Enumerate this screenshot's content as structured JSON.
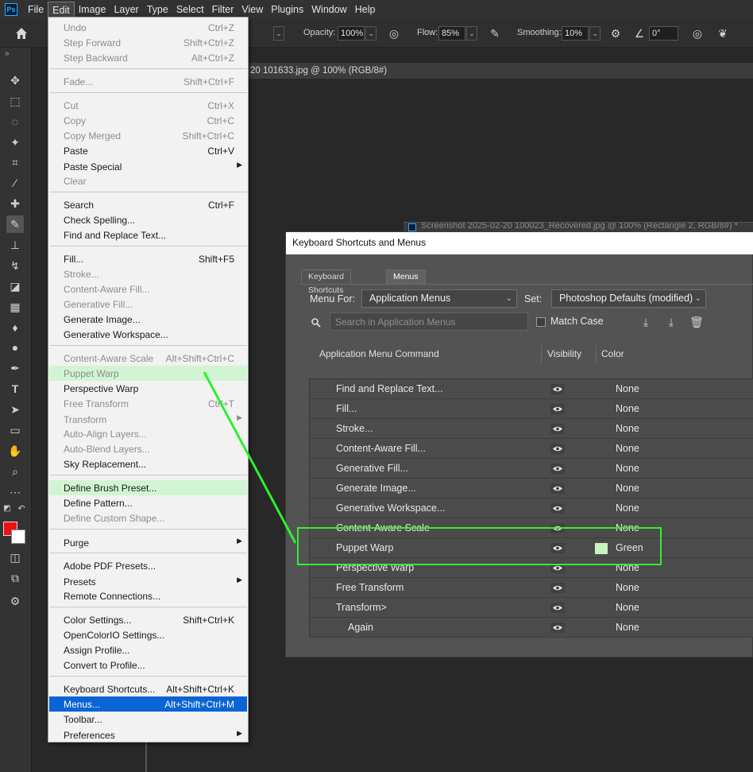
{
  "menubar": {
    "logo": "Ps",
    "items": [
      "File",
      "Edit",
      "Image",
      "Layer",
      "Type",
      "Select",
      "Filter",
      "View",
      "Plugins",
      "Window",
      "Help"
    ],
    "active": "Edit"
  },
  "options": {
    "opacity_label": "Opacity:",
    "opacity_value": "100%",
    "flow_label": "Flow:",
    "flow_value": "85%",
    "smoothing_label": "Smoothing:",
    "smoothing_value": "10%",
    "angle_value": "0°"
  },
  "doc": {
    "tab_title": "20 101633.jpg @ 100% (RGB/8#)",
    "second_tab_title": "Screenshot 2025-02-20 100023_Recovered.jpg @ 100% (Rectangle 2, RGB/8#) *"
  },
  "edit_menu": {
    "items": [
      {
        "label": "Undo",
        "shortcut": "Ctrl+Z",
        "disabled": true
      },
      {
        "label": "Step Forward",
        "shortcut": "Shift+Ctrl+Z",
        "disabled": true
      },
      {
        "label": "Step Backward",
        "shortcut": "Alt+Ctrl+Z",
        "disabled": true
      },
      {
        "label": "Fade...",
        "shortcut": "Shift+Ctrl+F",
        "disabled": true
      },
      {
        "label": "Cut",
        "shortcut": "Ctrl+X",
        "disabled": true
      },
      {
        "label": "Copy",
        "shortcut": "Ctrl+C",
        "disabled": true
      },
      {
        "label": "Copy Merged",
        "shortcut": "Shift+Ctrl+C",
        "disabled": true
      },
      {
        "label": "Paste",
        "shortcut": "Ctrl+V",
        "disabled": false
      },
      {
        "label": "Paste Special",
        "shortcut": "",
        "disabled": false,
        "submenu": true
      },
      {
        "label": "Clear",
        "shortcut": "",
        "disabled": true
      },
      {
        "label": "Search",
        "shortcut": "Ctrl+F",
        "disabled": false
      },
      {
        "label": "Check Spelling...",
        "shortcut": "",
        "disabled": false
      },
      {
        "label": "Find and Replace Text...",
        "shortcut": "",
        "disabled": false
      },
      {
        "label": "Fill...",
        "shortcut": "Shift+F5",
        "disabled": false
      },
      {
        "label": "Stroke...",
        "shortcut": "",
        "disabled": true
      },
      {
        "label": "Content-Aware Fill...",
        "shortcut": "",
        "disabled": true
      },
      {
        "label": "Generative Fill...",
        "shortcut": "",
        "disabled": true
      },
      {
        "label": "Generate Image...",
        "shortcut": "",
        "disabled": false
      },
      {
        "label": "Generative Workspace...",
        "shortcut": "",
        "disabled": false
      },
      {
        "label": "Content-Aware Scale",
        "shortcut": "Alt+Shift+Ctrl+C",
        "disabled": true
      },
      {
        "label": "Puppet Warp",
        "shortcut": "",
        "disabled": true,
        "highlight": true
      },
      {
        "label": "Perspective Warp",
        "shortcut": "",
        "disabled": false
      },
      {
        "label": "Free Transform",
        "shortcut": "Ctrl+T",
        "disabled": true
      },
      {
        "label": "Transform",
        "shortcut": "",
        "disabled": true,
        "submenu": true
      },
      {
        "label": "Auto-Align Layers...",
        "shortcut": "",
        "disabled": true
      },
      {
        "label": "Auto-Blend Layers...",
        "shortcut": "",
        "disabled": true
      },
      {
        "label": "Sky Replacement...",
        "shortcut": "",
        "disabled": false
      },
      {
        "label": "Define Brush Preset...",
        "shortcut": "",
        "disabled": false,
        "highlight": true
      },
      {
        "label": "Define Pattern...",
        "shortcut": "",
        "disabled": false
      },
      {
        "label": "Define Custom Shape...",
        "shortcut": "",
        "disabled": true
      },
      {
        "label": "Purge",
        "shortcut": "",
        "disabled": false,
        "submenu": true
      },
      {
        "label": "Adobe PDF Presets...",
        "shortcut": "",
        "disabled": false
      },
      {
        "label": "Presets",
        "shortcut": "",
        "disabled": false,
        "submenu": true
      },
      {
        "label": "Remote Connections...",
        "shortcut": "",
        "disabled": false
      },
      {
        "label": "Color Settings...",
        "shortcut": "Shift+Ctrl+K",
        "disabled": false
      },
      {
        "label": "OpenColorIO Settings...",
        "shortcut": "",
        "disabled": false
      },
      {
        "label": "Assign Profile...",
        "shortcut": "",
        "disabled": false
      },
      {
        "label": "Convert to Profile...",
        "shortcut": "",
        "disabled": false
      },
      {
        "label": "Keyboard Shortcuts...",
        "shortcut": "Alt+Shift+Ctrl+K",
        "disabled": false
      },
      {
        "label": "Menus...",
        "shortcut": "Alt+Shift+Ctrl+M",
        "disabled": false,
        "selected": true
      },
      {
        "label": "Toolbar...",
        "shortcut": "",
        "disabled": false
      },
      {
        "label": "Preferences",
        "shortcut": "",
        "disabled": false,
        "submenu": true
      }
    ]
  },
  "dialog": {
    "title": "Keyboard Shortcuts and Menus",
    "tabs": [
      "Keyboard Shortcuts",
      "Menus"
    ],
    "menu_for_label": "Menu For:",
    "menu_for_value": "Application Menus",
    "set_label": "Set:",
    "set_value": "Photoshop Defaults (modified)",
    "search_placeholder": "Search in Application Menus",
    "match_case_label": "Match Case",
    "col_command": "Application Menu Command",
    "col_visibility": "Visibility",
    "col_color": "Color",
    "rows": [
      {
        "command": "Find and Replace Text...",
        "color": "None",
        "indent": 1
      },
      {
        "command": "Fill...",
        "color": "None",
        "indent": 1
      },
      {
        "command": "Stroke...",
        "color": "None",
        "indent": 1
      },
      {
        "command": "Content-Aware Fill...",
        "color": "None",
        "indent": 1
      },
      {
        "command": "Generative Fill...",
        "color": "None",
        "indent": 1
      },
      {
        "command": "Generate Image...",
        "color": "None",
        "indent": 1
      },
      {
        "command": "Generative Workspace...",
        "color": "None",
        "indent": 1
      },
      {
        "command": "Content-Aware Scale",
        "color": "None",
        "indent": 1
      },
      {
        "command": "Puppet Warp",
        "color": "Green",
        "indent": 1,
        "swatch": "#c9f3c3"
      },
      {
        "command": "Perspective Warp",
        "color": "None",
        "indent": 1
      },
      {
        "command": "Free Transform",
        "color": "None",
        "indent": 1
      },
      {
        "command": "Transform>",
        "color": "None",
        "indent": 1
      },
      {
        "command": "Again",
        "color": "None",
        "indent": 2
      }
    ]
  },
  "colors": {
    "annotation": "#2ef02e",
    "menu_highlight": "#d1f5d3",
    "menu_selected": "#0a64d6",
    "foreground": "#ee1111"
  }
}
